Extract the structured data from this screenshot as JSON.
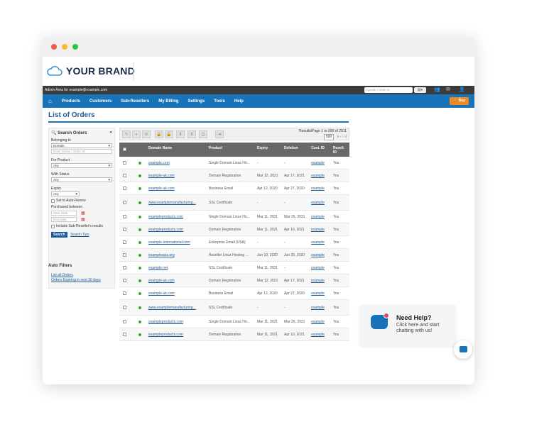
{
  "window": {
    "traffic_lights": {
      "close": "#f05a4f",
      "minimize": "#f5bd2a",
      "zoom": "#29c73f"
    }
  },
  "brand": {
    "text": "YOUR BRAND",
    "logo_icon": "cloud-icon",
    "accent": "#3897d3"
  },
  "admin_bar": {
    "label": "Admin Area for example@example.com",
    "search_placeholder": "Domain / Order ID"
  },
  "nav": {
    "items": [
      "Products",
      "Customers",
      "Sub-Resellers",
      "My Billing",
      "Settings",
      "Tools",
      "Help"
    ],
    "buy_label": "Buy",
    "color": "#1973b8"
  },
  "page_title": "List of Orders",
  "sidebar": {
    "title": "Search Orders",
    "belonging_label": "Belonging to",
    "belonging_value": "Domain",
    "name_placeholder": "Enter Name / Order ID",
    "product_label": "For Product",
    "product_value": "Any",
    "status_label": "With Status",
    "status_value": "Any",
    "expiry_label": "Expiry",
    "expiry_value": "Any",
    "auto_renew_label": "Set to Auto-Renew",
    "purchased_label": "Purchased between",
    "start_placeholder": "Start Date",
    "end_placeholder": "End Date",
    "include_label": "Include Sub-Reseller's results",
    "search_button": "Search",
    "search_tips": "Search Tips"
  },
  "auto_filters": {
    "title": "Auto Filters",
    "links": [
      "List all Orders",
      "Orders Expiring in next 30 days"
    ]
  },
  "toolbar": {
    "results_label": "Results/Page",
    "results_value": "500",
    "range": "1 to 500 of 2911",
    "page_nav": "|‹  ‹  ›  ›|"
  },
  "table": {
    "headers": [
      "Domain Name",
      "Product",
      "Expiry",
      "Deletion",
      "Cust. ID",
      "Resell. ID"
    ],
    "rows": [
      {
        "domain": "example.com",
        "product": "Single Domain Linux Ho...",
        "expiry": "-",
        "deletion": "-",
        "cust": "example",
        "res": "You"
      },
      {
        "domain": "example-uk.com",
        "product": "Domain Registration",
        "expiry": "Mar 12, 2021",
        "deletion": "Apr 17, 2021",
        "cust": "example",
        "res": "You"
      },
      {
        "domain": "example-uk.com",
        "product": "Business Email",
        "expiry": "Apr 12, 2020",
        "deletion": "Apr 27, 2020",
        "cust": "example",
        "res": "You"
      },
      {
        "domain": "www.examplemanufacturing...",
        "product": "SSL Certificate",
        "expiry": "-",
        "deletion": "-",
        "cust": "example",
        "res": "You"
      },
      {
        "domain": "exampleproducts.com",
        "product": "Single Domain Linux Ho...",
        "expiry": "Mar 11, 2021",
        "deletion": "Mar 26, 2021",
        "cust": "example",
        "res": "You"
      },
      {
        "domain": "exampleproducts.com",
        "product": "Domain Registration",
        "expiry": "Mar 11, 2021",
        "deletion": "Apr 16, 2021",
        "cust": "example",
        "res": "You"
      },
      {
        "domain": "example-international.com",
        "product": "Enterprise Email (USA)",
        "expiry": "-",
        "deletion": "-",
        "cust": "example",
        "res": "You"
      },
      {
        "domain": "exampleasia.org",
        "product": "Reseller Linux Hosting ...",
        "expiry": "Jun 10, 2020",
        "deletion": "Jun 25, 2020",
        "cust": "example",
        "res": "You"
      },
      {
        "domain": "example.net",
        "product": "SSL Certificate",
        "expiry": "Mar 11, 2021",
        "deletion": "-",
        "cust": "example",
        "res": "You"
      },
      {
        "domain": "example-uk.com",
        "product": "Domain Registration",
        "expiry": "Mar 12, 2021",
        "deletion": "Apr 17, 2021",
        "cust": "example",
        "res": "You"
      },
      {
        "domain": "example-uk.com",
        "product": "Business Email",
        "expiry": "Apr 12, 2020",
        "deletion": "Apr 27, 2020",
        "cust": "example",
        "res": "You"
      },
      {
        "domain": "www.examplemanufacturing...",
        "product": "SSL Certificate",
        "expiry": "-",
        "deletion": "-",
        "cust": "example",
        "res": "You"
      },
      {
        "domain": "exampleproducts.com",
        "product": "Single Domain Linux Ho...",
        "expiry": "Mar 11, 2021",
        "deletion": "Mar 26, 2021",
        "cust": "example",
        "res": "You"
      },
      {
        "domain": "exampleproducts.com",
        "product": "Domain Registration",
        "expiry": "Mar 11, 2021",
        "deletion": "Apr 16, 2021",
        "cust": "example",
        "res": "You"
      }
    ]
  },
  "help": {
    "title": "Need Help?",
    "subtitle": "Click here and start chatting with us!",
    "badge_color": "#e4455c"
  }
}
